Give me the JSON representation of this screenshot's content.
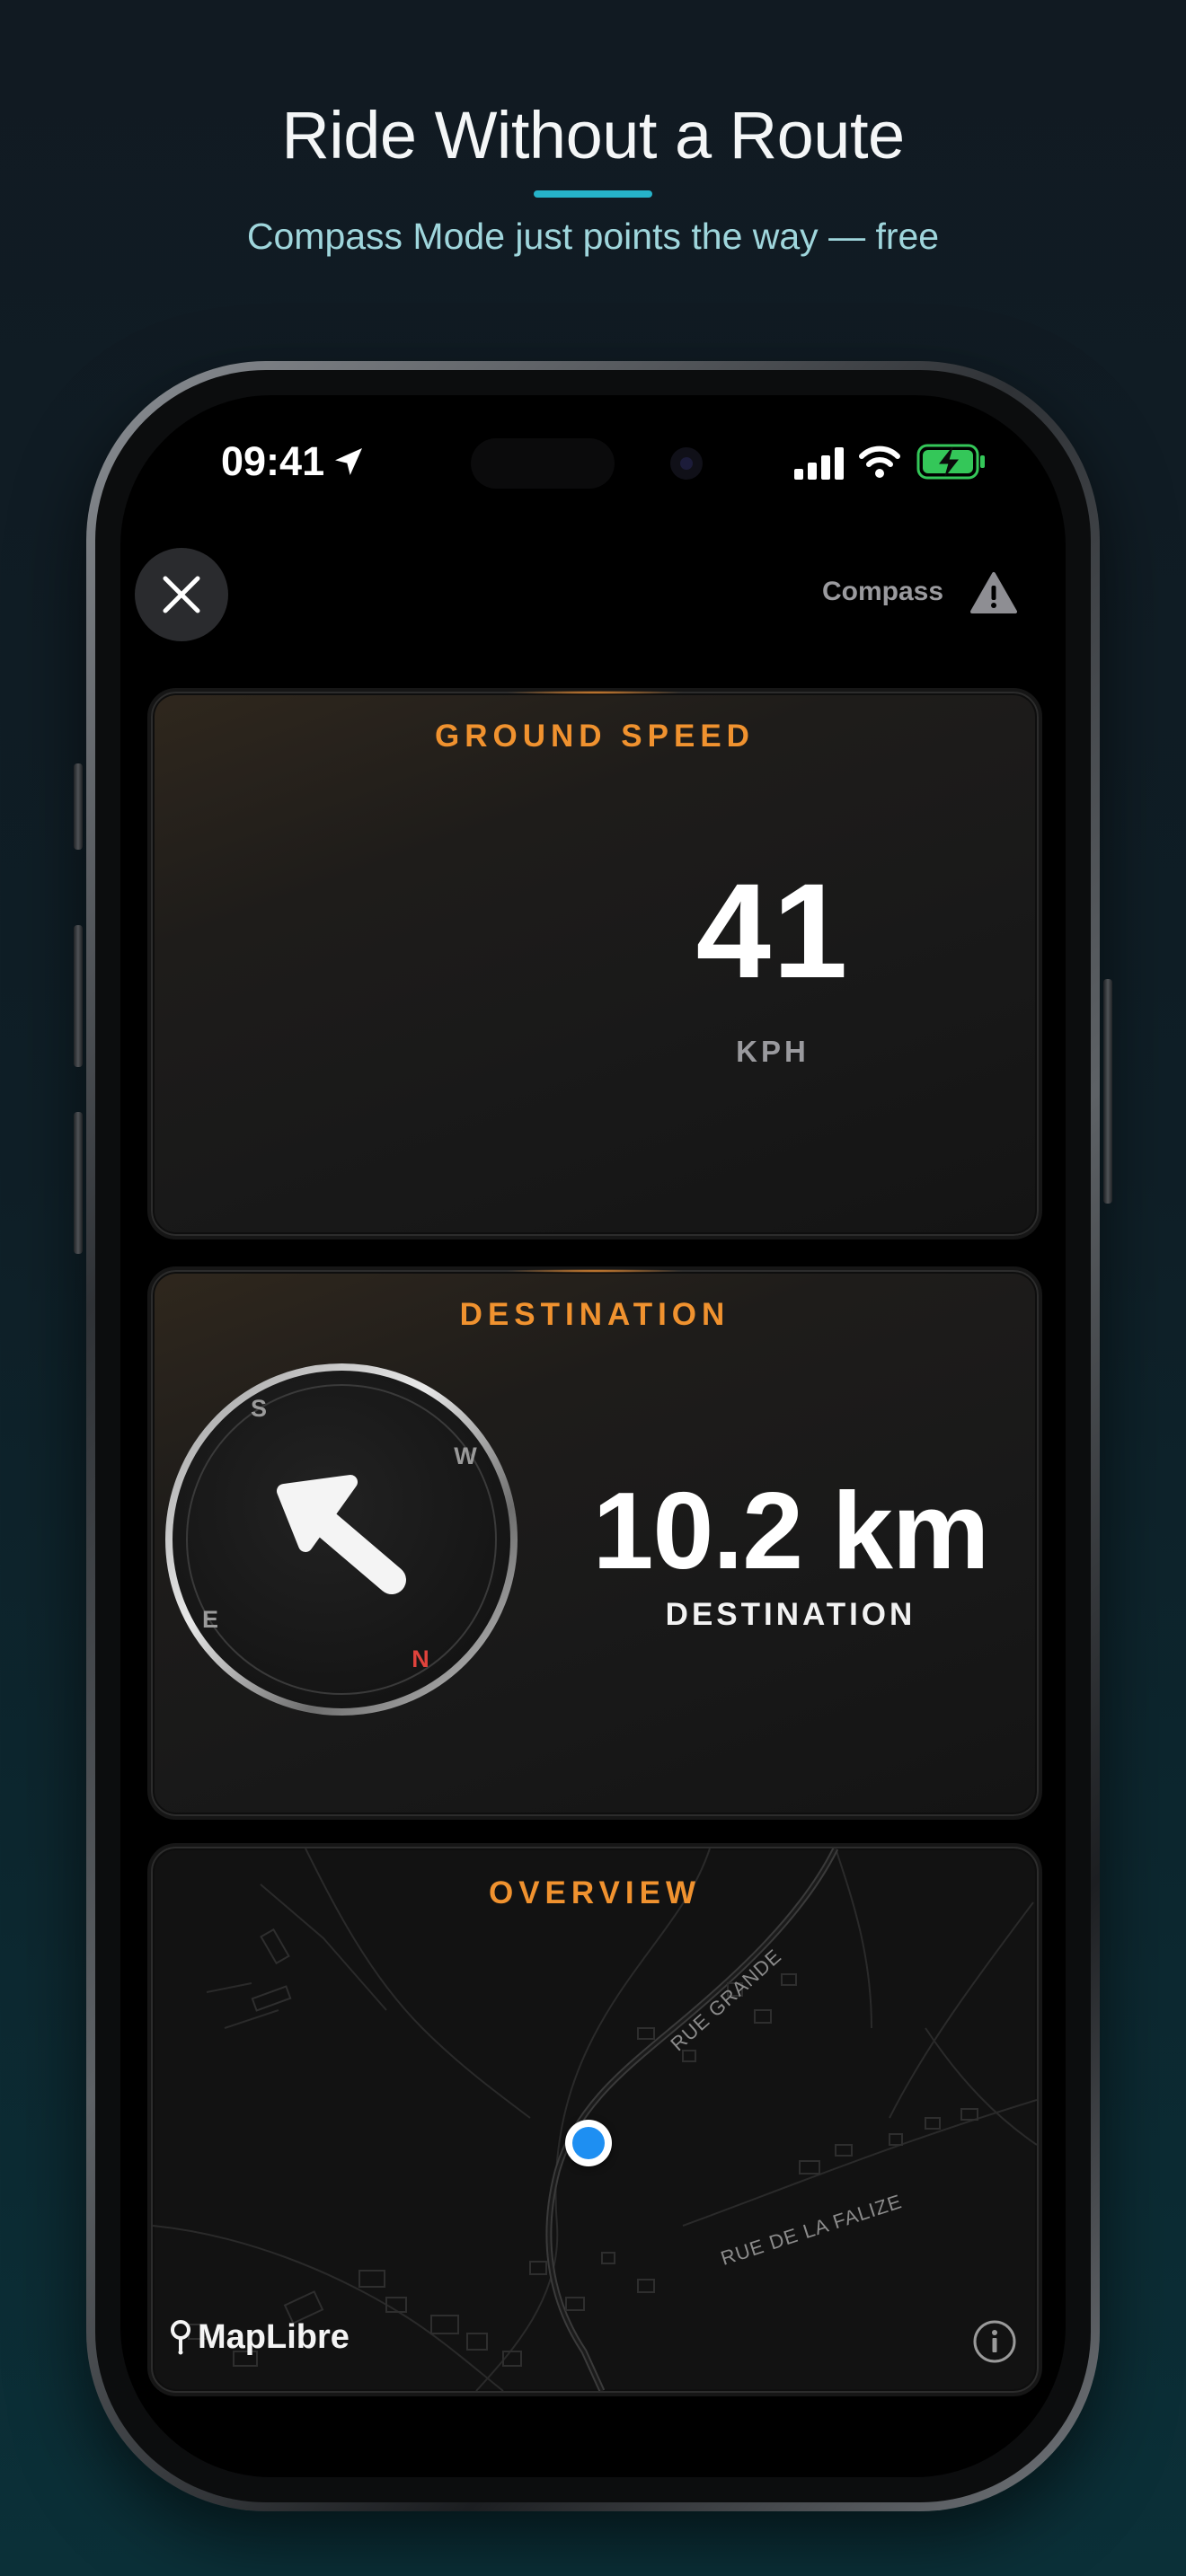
{
  "promo": {
    "headline": "Ride Without a Route",
    "subheadline": "Compass Mode just points the way — free",
    "accent_color": "#26b3c9"
  },
  "status_bar": {
    "time": "09:41",
    "icons": [
      "location-arrow-icon",
      "cellular-signal-icon",
      "wifi-icon",
      "battery-charging-icon"
    ],
    "battery_color": "#34c759"
  },
  "toolbar": {
    "close_icon": "close-icon",
    "mode_label": "Compass",
    "warning_icon": "warning-triangle-icon"
  },
  "ground_speed": {
    "title": "GROUND SPEED",
    "value": "41",
    "unit": "KPH"
  },
  "destination": {
    "title": "DESTINATION",
    "value": "10.2 km",
    "label": "DESTINATION",
    "compass": {
      "labels": {
        "north": "N",
        "east": "E",
        "south": "S",
        "west": "W"
      },
      "north_color": "#e0433c",
      "arrow_icon": "direction-arrow-icon"
    }
  },
  "overview": {
    "title": "OVERVIEW",
    "streets": [
      "RUE GRANDE",
      "RUE DE LA FALIZE"
    ],
    "attribution": "MapLibre",
    "location_color": "#1e8ff2"
  },
  "theme": {
    "card_title_color": "#f0922f"
  }
}
